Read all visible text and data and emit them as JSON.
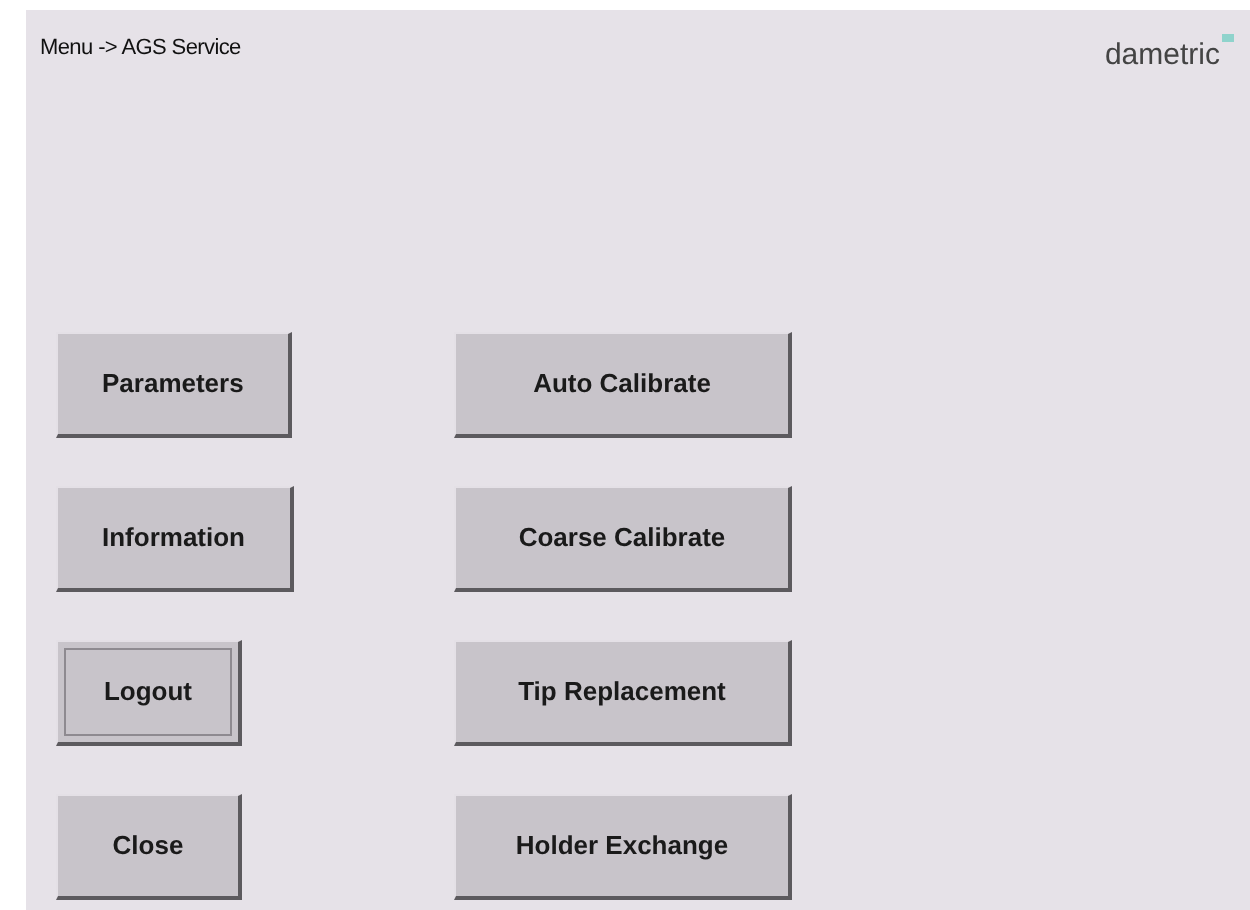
{
  "header": {
    "breadcrumb": "Menu -> AGS Service",
    "logo": "dametric"
  },
  "left_buttons": [
    {
      "label": "Parameters",
      "focused": false
    },
    {
      "label": "Information",
      "focused": false
    },
    {
      "label": "Logout",
      "focused": true
    },
    {
      "label": "Close",
      "focused": false
    }
  ],
  "right_buttons": [
    {
      "label": "Auto Calibrate",
      "focused": false
    },
    {
      "label": "Coarse Calibrate",
      "focused": false
    },
    {
      "label": "Tip Replacement",
      "focused": false
    },
    {
      "label": "Holder Exchange",
      "focused": false
    }
  ]
}
